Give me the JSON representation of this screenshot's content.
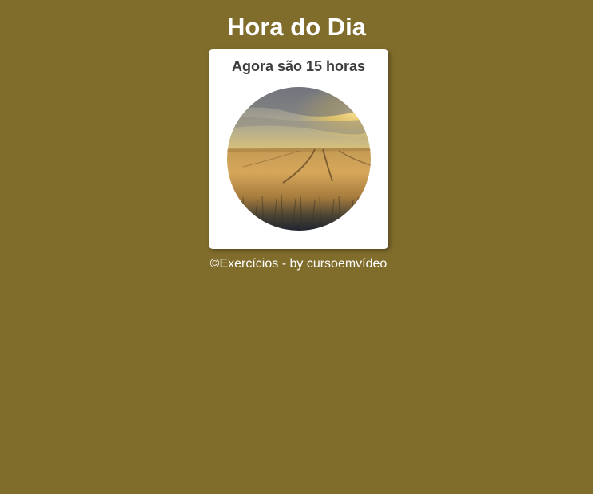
{
  "header": {
    "title": "Hora do Dia"
  },
  "main": {
    "message": "Agora são 15 horas",
    "image": {
      "subject": "wheat-field-afternoon",
      "colors": {
        "sky_top": "#7d8087",
        "sky_glow": "#f2cd5c",
        "field_light": "#d2a354",
        "field_dark": "#2a2c33"
      }
    }
  },
  "footer": {
    "text": "©Exercícios - by cursoemvídeo"
  },
  "theme": {
    "background": "#816d2b",
    "card": "#ffffff",
    "text_dark": "#3d3d3d",
    "text_light": "#ffffff"
  }
}
